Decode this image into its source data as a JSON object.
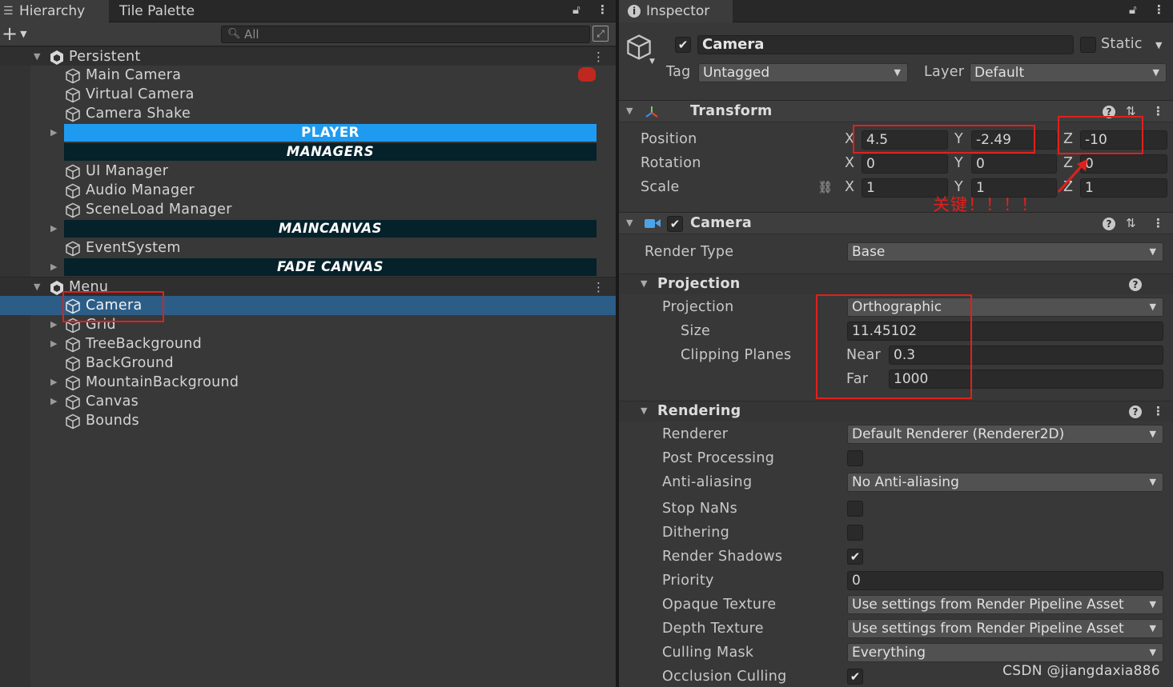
{
  "hierarchy": {
    "tabs": [
      {
        "label": "Hierarchy"
      },
      {
        "label": "Tile Palette"
      }
    ],
    "add_symbol": "+",
    "search_placeholder": "All",
    "scenes": [
      {
        "name": "Persistent"
      },
      {
        "name": "Menu"
      }
    ],
    "items": {
      "main_camera": "Main Camera",
      "virtual_camera": "Virtual Camera",
      "camera_shake": "Camera Shake",
      "player": "PLAYER",
      "managers": "MANAGERS",
      "ui_manager": "UI Manager",
      "audio_manager": "Audio Manager",
      "sceneload_manager": "SceneLoad Manager",
      "maincanvas": "MAINCANVAS",
      "eventsystem": "EventSystem",
      "fade_canvas": "FADE CANVAS",
      "camera": "Camera",
      "grid": "Grid",
      "tree_background": "TreeBackground",
      "background": "BackGround",
      "mountain_background": "MountainBackground",
      "canvas": "Canvas",
      "bounds": "Bounds"
    },
    "colors": {
      "player_banner": "#1e9bf0",
      "dark_banner": "#05212a",
      "selection": "#2c5d87"
    }
  },
  "inspector": {
    "tab_label": "Inspector",
    "object_name": "Camera",
    "active_checked": true,
    "static_label": "Static",
    "tag_label": "Tag",
    "tag_value": "Untagged",
    "layer_label": "Layer",
    "layer_value": "Default",
    "transform": {
      "title": "Transform",
      "position_label": "Position",
      "rotation_label": "Rotation",
      "scale_label": "Scale",
      "axis_x": "X",
      "axis_y": "Y",
      "axis_z": "Z",
      "position": {
        "x": "4.5",
        "y": "-2.49",
        "z": "-10"
      },
      "rotation": {
        "x": "0",
        "y": "0",
        "z": "0"
      },
      "scale": {
        "x": "1",
        "y": "1",
        "z": "1"
      }
    },
    "annotation": "关键！！！！",
    "camera": {
      "title": "Camera",
      "render_type_label": "Render Type",
      "render_type_value": "Base",
      "projection_section": "Projection",
      "projection_label": "Projection",
      "projection_value": "Orthographic",
      "size_label": "Size",
      "size_value": "11.45102",
      "clipping_label": "Clipping Planes",
      "near_label": "Near",
      "near_value": "0.3",
      "far_label": "Far",
      "far_value": "1000",
      "rendering_section": "Rendering",
      "renderer_label": "Renderer",
      "renderer_value": "Default Renderer (Renderer2D)",
      "post_processing_label": "Post Processing",
      "post_processing_checked": false,
      "anti_aliasing_label": "Anti-aliasing",
      "anti_aliasing_value": "No Anti-aliasing",
      "stop_nans_label": "Stop NaNs",
      "stop_nans_checked": false,
      "dithering_label": "Dithering",
      "dithering_checked": false,
      "render_shadows_label": "Render Shadows",
      "render_shadows_checked": true,
      "priority_label": "Priority",
      "priority_value": "0",
      "opaque_texture_label": "Opaque Texture",
      "opaque_texture_value": "Use settings from Render Pipeline Asset",
      "depth_texture_label": "Depth Texture",
      "depth_texture_value": "Use settings from Render Pipeline Asset",
      "culling_mask_label": "Culling Mask",
      "culling_mask_value": "Everything",
      "occlusion_culling_label": "Occlusion Culling",
      "occlusion_culling_checked": true
    },
    "colors": {
      "annotation_red": "#e0201c"
    }
  },
  "watermark": "CSDN @jiangdaxia886"
}
